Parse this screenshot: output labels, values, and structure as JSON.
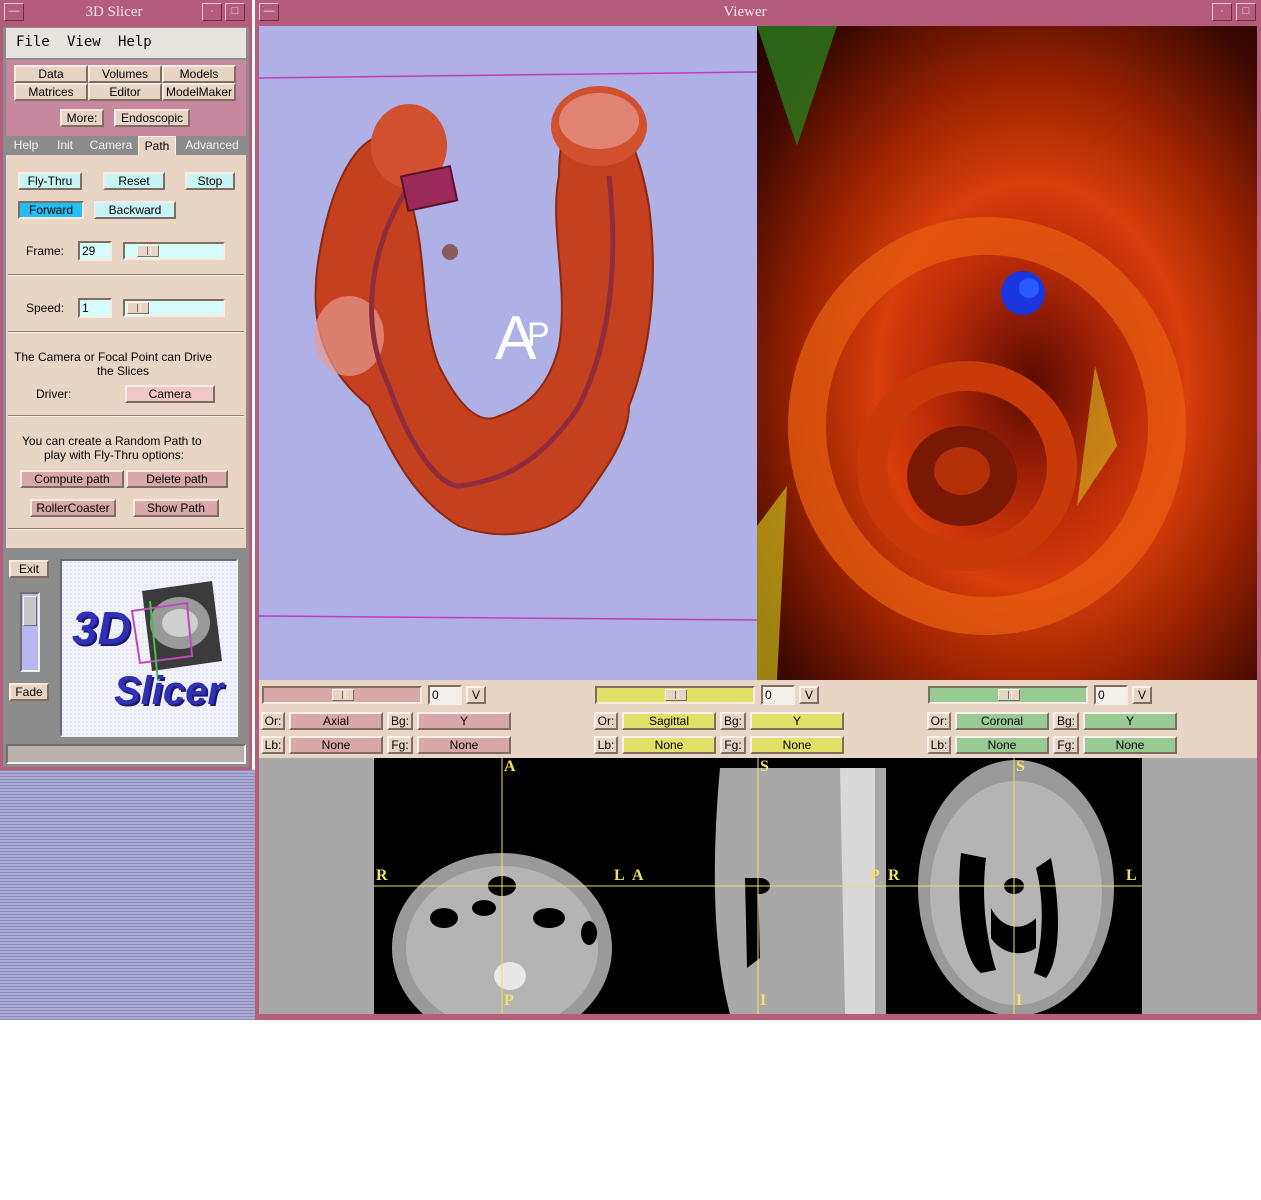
{
  "slicer_window": {
    "title": "3D Slicer",
    "menu": [
      "File",
      "View",
      "Help"
    ],
    "modules": {
      "row1": [
        "Data",
        "Volumes",
        "Models"
      ],
      "row2": [
        "Matrices",
        "Editor",
        "ModelMaker"
      ],
      "more_label": "More:",
      "more_value": "Endoscopic"
    },
    "tabs": [
      "Help",
      "Init",
      "Camera",
      "Path",
      "Advanced"
    ],
    "active_tab": "Path",
    "path_panel": {
      "fly_thru": "Fly-Thru",
      "reset": "Reset",
      "stop": "Stop",
      "forward": "Forward",
      "backward": "Backward",
      "frame_label": "Frame:",
      "frame_value": "29",
      "speed_label": "Speed:",
      "speed_value": "1",
      "driver_text_1": "The Camera or Focal Point can Drive",
      "driver_text_2": "the Slices",
      "driver_label": "Driver:",
      "driver_value": "Camera",
      "random_text_1": "You can create a Random Path to",
      "random_text_2": "play with Fly-Thru options:",
      "compute_path": "Compute path",
      "delete_path": "Delete path",
      "roller_coaster": "RollerCoaster",
      "show_path": "Show Path"
    },
    "exit": "Exit",
    "fade": "Fade",
    "logo_text_1": "3D",
    "logo_text_2": "Slicer"
  },
  "viewer_window": {
    "title": "Viewer",
    "orientation_label": "A",
    "orientation_label_2": "P",
    "slices": [
      {
        "slider_value": "0",
        "v": "V",
        "or_label": "Or:",
        "or_value": "Axial",
        "bg_label": "Bg:",
        "bg_value": "Y",
        "lb_label": "Lb:",
        "lb_value": "None",
        "fg_label": "Fg:",
        "fg_value": "None",
        "color": "#d9a9a9",
        "labels": {
          "top": "A",
          "bottom": "P",
          "left": "R",
          "right": "L"
        }
      },
      {
        "slider_value": "0",
        "v": "V",
        "or_label": "Or:",
        "or_value": "Sagittal",
        "bg_label": "Bg:",
        "bg_value": "Y",
        "lb_label": "Lb:",
        "lb_value": "None",
        "fg_label": "Fg:",
        "fg_value": "None",
        "color": "#e3e06a",
        "labels": {
          "top": "S",
          "bottom": "I",
          "left": "A",
          "right": "P"
        }
      },
      {
        "slider_value": "0",
        "v": "V",
        "or_label": "Or:",
        "or_value": "Coronal",
        "bg_label": "Bg:",
        "bg_value": "Y",
        "lb_label": "Lb:",
        "lb_value": "None",
        "fg_label": "Fg:",
        "fg_value": "None",
        "color": "#98cb94",
        "labels": {
          "top": "S",
          "bottom": "I",
          "left": "R",
          "right": "L"
        }
      }
    ]
  },
  "colors": {
    "frame": "#b35c7b",
    "panel": "#e9d5c3",
    "view_3d_bg": "#aeb0e6",
    "forward_active": "#21bff2"
  }
}
